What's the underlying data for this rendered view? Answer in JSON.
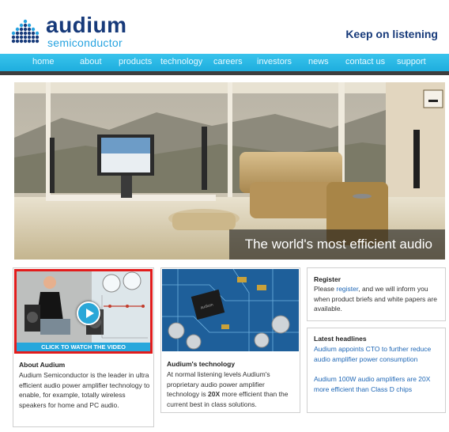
{
  "header": {
    "brand": "audium",
    "sub": "semiconductor",
    "tagline": "Keep on listening"
  },
  "nav": {
    "items": [
      "home",
      "about",
      "products",
      "technology",
      "careers",
      "investors",
      "news",
      "contact us",
      "support"
    ]
  },
  "hero": {
    "caption": "The world's most efficient audio"
  },
  "about": {
    "video_label": "CLICK TO WATCH THE VIDEO",
    "title": "About Audium",
    "text": "Audium Semiconductor is the leader in ultra efficient audio power amplifier technology to enable, for example, totally wireless speakers for home and PC audio."
  },
  "tech": {
    "title": "Audium's technology",
    "text_before": "At normal listening levels Audium's proprietary audio power amplifier technology is ",
    "bold": "20X",
    "text_after": " more efficient than the current best in class solutions."
  },
  "register": {
    "title": "Register",
    "text_before": "Please ",
    "link": "register",
    "text_after": ", and we will inform you when product briefs and white papers are available."
  },
  "news": {
    "title": "Latest headlines",
    "items": [
      "Audium appoints CTO to further reduce audio amplifier power consumption",
      "Audium 100W audio amplifiers are 20X more efficient than Class D chips"
    ]
  },
  "colors": {
    "navy": "#173a7a",
    "cyan": "#26a3e0",
    "nav": "#1eaede",
    "link": "#2068b6",
    "video_border": "#e21c1c"
  }
}
